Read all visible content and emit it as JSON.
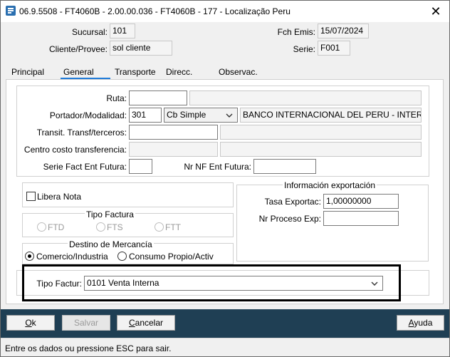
{
  "window": {
    "title": "06.9.5508 - FT4060B - 2.00.00.036 - FT4060B - 177 - Localização Peru",
    "close_glyph": "✕"
  },
  "header": {
    "sucursal_label": "Sucursal:",
    "sucursal_value": "101",
    "fch_emis_label": "Fch Emis:",
    "fch_emis_value": "15/07/2024",
    "cliente_label": "Cliente/Provee:",
    "cliente_value": "sol cliente",
    "serie_label": "Serie:",
    "serie_value": "F001"
  },
  "tabs": [
    {
      "label": "Principal"
    },
    {
      "label": "General"
    },
    {
      "label": "Transporte"
    },
    {
      "label": "Direcc."
    },
    {
      "label": "Observac."
    }
  ],
  "active_tab": "General",
  "general": {
    "ruta_label": "Ruta:",
    "ruta_value": "",
    "portador_label": "Portador/Modalidad:",
    "portador_value": "301",
    "modalidad_value": "Cb Simple",
    "banco_value": "BANCO INTERNACIONAL DEL PERU - INTERBANK",
    "transit_label": "Transit. Transf/terceros:",
    "centro_label": "Centro costo transferencia:",
    "serie_fact_label": "Serie Fact Ent Futura:",
    "nr_nf_label": "Nr NF Ent Futura:"
  },
  "libera_nota": {
    "label": "Libera Nota",
    "checked": false
  },
  "info_exportacion": {
    "title": "Información exportación",
    "tasa_label": "Tasa Exportac:",
    "tasa_value": "1,00000000",
    "nr_proceso_label": "Nr Proceso Exp:",
    "nr_proceso_value": ""
  },
  "tipo_factura": {
    "title": "Tipo Factura",
    "options": [
      {
        "label": "FTD",
        "selected": false
      },
      {
        "label": "FTS",
        "selected": true
      },
      {
        "label": "FTT",
        "selected": false
      }
    ]
  },
  "destino_mercancia": {
    "title": "Destino de Mercancía",
    "options": [
      {
        "label": "Comercio/Industria",
        "selected": true
      },
      {
        "label": "Consumo Propio/Activ",
        "selected": false
      }
    ]
  },
  "tipo_factur": {
    "label": "Tipo Factur:",
    "value": "0101 Venta Interna"
  },
  "buttons": {
    "ok_first": "O",
    "ok_rest": "k",
    "salvar": "Salvar",
    "cancelar_first": "C",
    "cancelar_rest": "ancelar",
    "ayuda_first": "A",
    "ayuda_rest": "yuda"
  },
  "status": {
    "text": "Entre os dados ou pressione ESC para sair."
  },
  "colors": {
    "accent": "#1e7ad8",
    "bottom_bar": "#1f3f54"
  }
}
